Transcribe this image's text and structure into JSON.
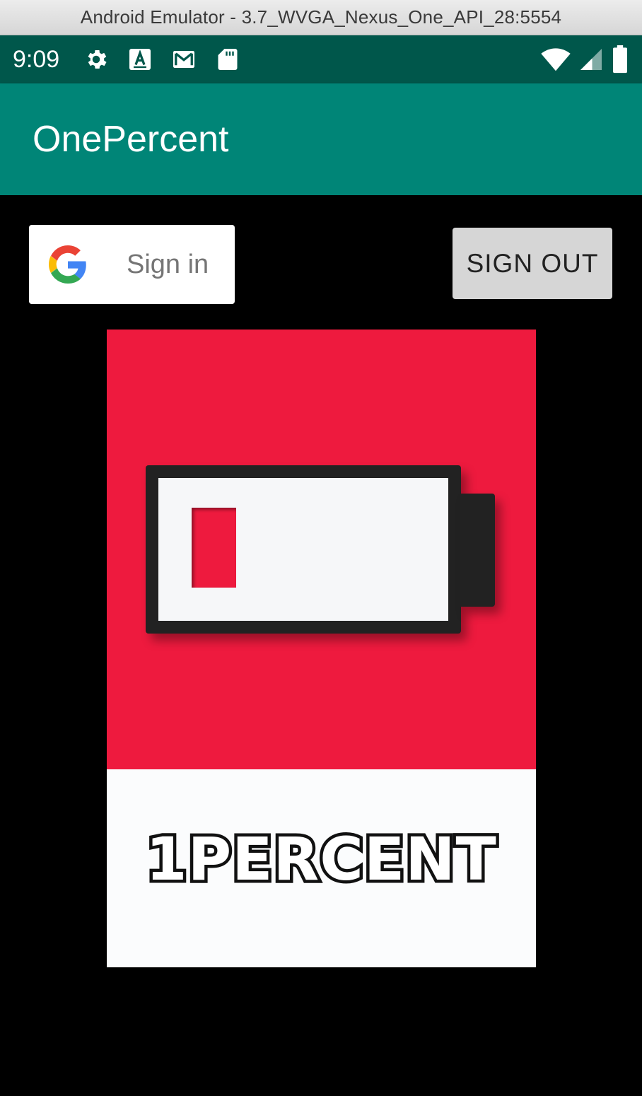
{
  "window": {
    "title": "Android Emulator - 3.7_WVGA_Nexus_One_API_28:5554"
  },
  "statusbar": {
    "time": "9:09",
    "icons_left": [
      "gear-icon",
      "accessibility-a-icon",
      "gmail-icon",
      "sd-card-icon"
    ],
    "icons_right": [
      "wifi-icon",
      "signal-icon",
      "battery-icon"
    ]
  },
  "appbar": {
    "title": "OnePercent",
    "color": "#008577",
    "status_color": "#00574b"
  },
  "google_signin": {
    "label": "Sign in",
    "icon": "google-g-icon"
  },
  "signout": {
    "label": "SIGN OUT"
  },
  "logo": {
    "text": "1PERCENT",
    "red": "#ee1a3e",
    "battery_level_fraction": 0.15
  }
}
